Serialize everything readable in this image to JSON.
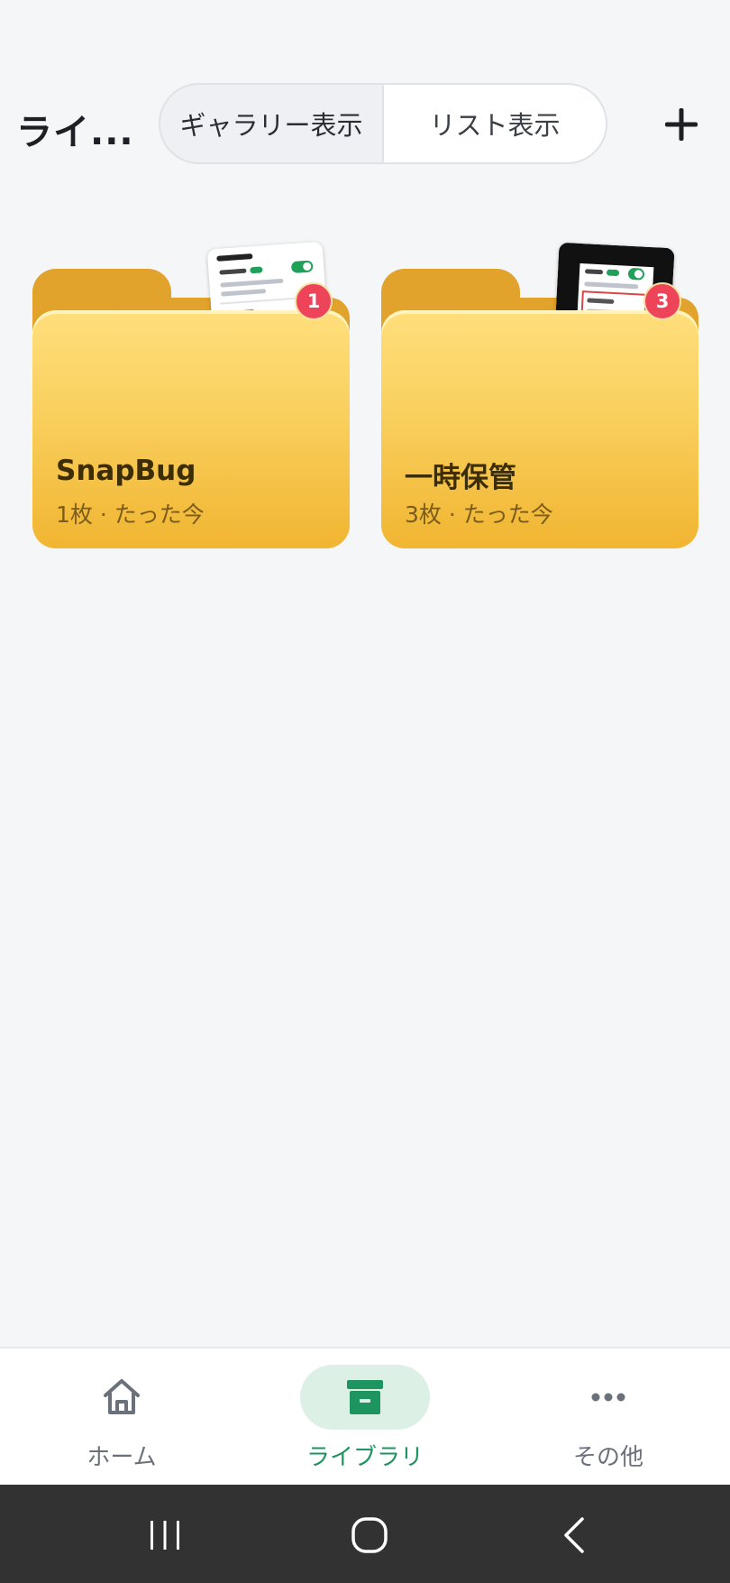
{
  "header": {
    "title": "ライ...",
    "view_toggle": {
      "gallery_label": "ギャラリー表示",
      "list_label": "リスト表示",
      "selected": "リスト表示"
    },
    "add_icon": "plus-icon"
  },
  "folders": [
    {
      "name": "SnapBug",
      "meta": "1枚 · たった今",
      "badge": "1"
    },
    {
      "name": "一時保管",
      "meta": "3枚 · たった今",
      "badge": "3"
    }
  ],
  "bottom_nav": {
    "items": [
      {
        "label": "ホーム",
        "icon": "home-icon"
      },
      {
        "label": "ライブラリ",
        "icon": "archive-box-icon",
        "active": true
      },
      {
        "label": "その他",
        "icon": "more-dots-icon"
      }
    ]
  },
  "system_nav": {
    "icons": [
      "recent-apps-icon",
      "home-circle-icon",
      "back-chevron-icon"
    ]
  },
  "colors": {
    "accent": "#1e9560",
    "badge": "#ee4459",
    "folder_light": "#ffdf7c",
    "folder_dark": "#f1b531"
  }
}
